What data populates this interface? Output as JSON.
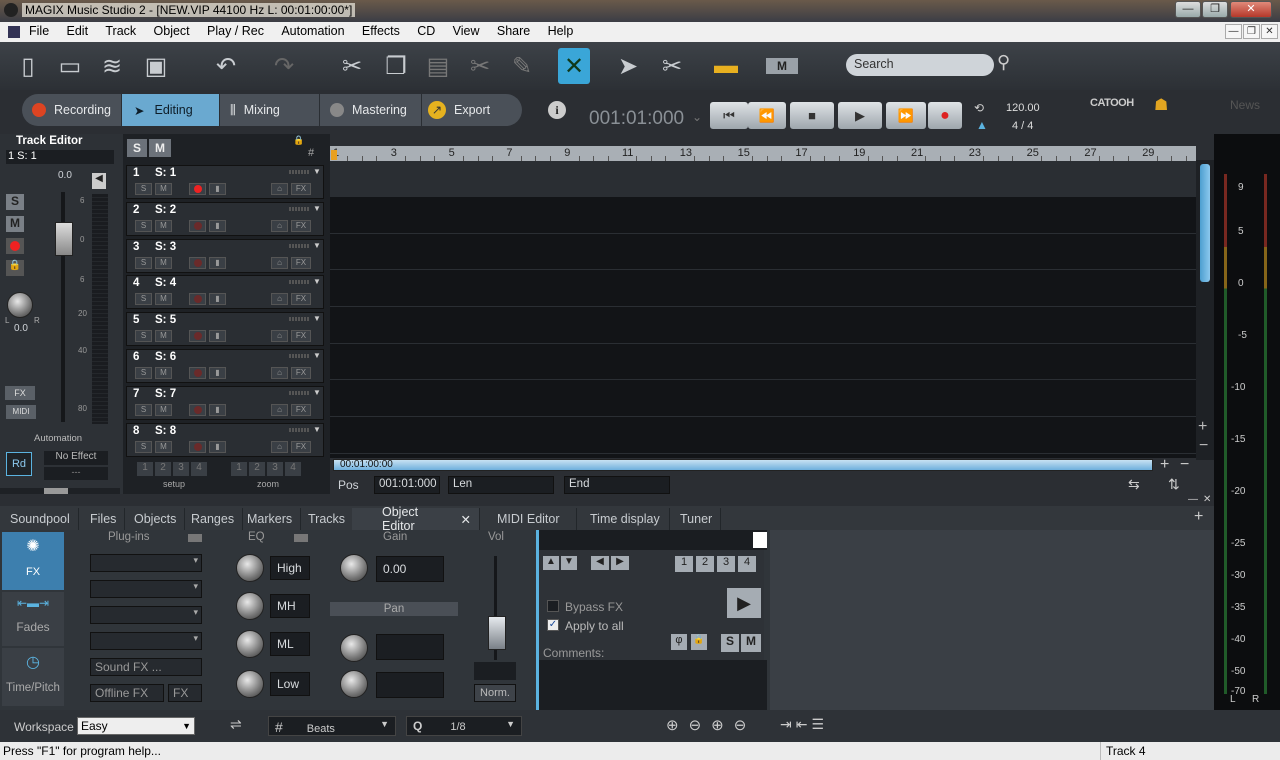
{
  "window": {
    "title": "MAGIX Music Studio 2 - [NEW.VIP  44100 Hz L: 00:01:00:00*]",
    "minimize": "—",
    "restore": "❐",
    "close": "✕"
  },
  "menu": [
    "File",
    "Edit",
    "Track",
    "Object",
    "Play / Rec",
    "Automation",
    "Effects",
    "CD",
    "View",
    "Share",
    "Help"
  ],
  "search": {
    "placeholder": "Search"
  },
  "modes": [
    {
      "label": "Recording"
    },
    {
      "label": "Editing"
    },
    {
      "label": "Mixing"
    },
    {
      "label": "Mastering"
    },
    {
      "label": "Export"
    }
  ],
  "transport": {
    "position": "001:01:000",
    "tempo": "120.00",
    "signature": "4 / 4"
  },
  "brand": {
    "catooh": "CATOOH",
    "news": "News"
  },
  "track_editor": {
    "title": "Track Editor",
    "selector": "1   S: 1",
    "volume": "0.0",
    "pan_value": "0.0",
    "pan_l": "L",
    "pan_r": "R",
    "scale": [
      "6",
      "0",
      "6",
      "20",
      "40",
      "80"
    ],
    "fx": "FX",
    "midi": "MIDI",
    "automation": "Automation",
    "rd": "Rd",
    "no_effect": "No Effect"
  },
  "header_buttons": {
    "solo": "S",
    "mute": "M"
  },
  "tracks": [
    {
      "num": "1",
      "name": "S: 1"
    },
    {
      "num": "2",
      "name": "S: 2"
    },
    {
      "num": "3",
      "name": "S: 3"
    },
    {
      "num": "4",
      "name": "S: 4"
    },
    {
      "num": "5",
      "name": "S: 5"
    },
    {
      "num": "6",
      "name": "S: 6"
    },
    {
      "num": "7",
      "name": "S: 7"
    },
    {
      "num": "8",
      "name": "S: 8"
    }
  ],
  "track_fx": "FX",
  "setup": {
    "label": "setup",
    "nums": [
      "1",
      "2",
      "3",
      "4"
    ]
  },
  "zoom": {
    "label": "zoom",
    "nums": [
      "1",
      "2",
      "3",
      "4"
    ]
  },
  "ruler": [
    "1",
    "3",
    "5",
    "7",
    "9",
    "11",
    "13",
    "15",
    "17",
    "19",
    "21",
    "23",
    "25",
    "27",
    "29"
  ],
  "range_bar": "00:01:00:00",
  "pos_bar": {
    "pos_label": "Pos",
    "pos_value": "001:01:000",
    "len_label": "Len",
    "end_label": "End"
  },
  "meter_scale": [
    "9",
    "5",
    "0",
    "-5",
    "-10",
    "-15",
    "-20",
    "-25",
    "-30",
    "-35",
    "-40",
    "-50",
    "-70"
  ],
  "meter_lr": [
    "L",
    "R"
  ],
  "bottom_tabs": [
    "Soundpool",
    "Files",
    "Objects",
    "Ranges",
    "Markers",
    "Tracks",
    "Object Editor",
    "MIDI Editor",
    "Time display",
    "Tuner"
  ],
  "object_editor": {
    "side": [
      "FX",
      "Fades",
      "Time/Pitch"
    ],
    "plugins_title": "Plug-ins",
    "eq_title": "EQ",
    "gain_title": "Gain",
    "vol_title": "Vol",
    "pan_title": "Pan",
    "eq_bands": [
      "High",
      "MH",
      "ML",
      "Low"
    ],
    "gain_value": "0.00",
    "sound_fx": "Sound FX ...",
    "offline_fx": "Offline FX",
    "fx": "FX",
    "norm": "Norm.",
    "presets": [
      "1",
      "2",
      "3",
      "4"
    ],
    "bypass": "Bypass FX",
    "apply_all": "Apply to all",
    "comments": "Comments:",
    "s": "S",
    "m": "M"
  },
  "footer": {
    "workspace_label": "Workspace",
    "workspace_value": "Easy",
    "grid_value": "Beats",
    "q_label": "Q",
    "q_value": "1/8"
  },
  "status": {
    "help": "Press \"F1\" for program help...",
    "track": "Track 4"
  }
}
